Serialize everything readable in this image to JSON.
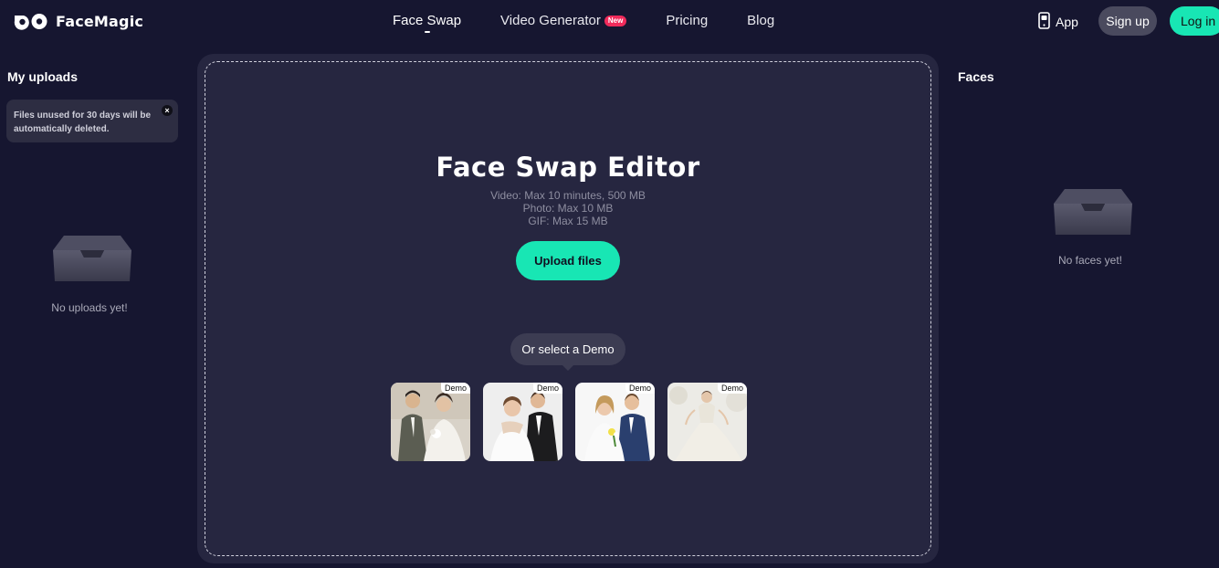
{
  "header": {
    "logo_text": "FaceMagic",
    "nav": [
      {
        "label": "Face Swap"
      },
      {
        "label": "Video Generator",
        "badge": "New"
      },
      {
        "label": "Pricing"
      },
      {
        "label": "Blog"
      }
    ],
    "app_label": "App",
    "signup_label": "Sign up",
    "login_label": "Log in"
  },
  "uploads": {
    "title": "My uploads",
    "notice": "Files unused for 30 days will be automatically deleted.",
    "close_symbol": "×",
    "empty_text": "No uploads yet!"
  },
  "editor": {
    "title": "Face Swap Editor",
    "limits": [
      "Video: Max 10 minutes, 500 MB",
      "Photo: Max 10 MB",
      "GIF: Max 15 MB"
    ],
    "upload_label": "Upload files",
    "demo_prompt": "Or select a Demo",
    "demos": [
      {
        "tag": "Demo"
      },
      {
        "tag": "Demo"
      },
      {
        "tag": "Demo"
      },
      {
        "tag": "Demo"
      }
    ]
  },
  "faces": {
    "title": "Faces",
    "empty_text": "No faces yet!"
  },
  "icons": {
    "logo": "facemagic-logo-icon",
    "app": "phone-icon",
    "close": "close-icon",
    "empty": "empty-tray-icon"
  },
  "colors": {
    "background": "#161630",
    "panel": "#262640",
    "accent": "#18e6b4",
    "badge": "#f02b5b"
  }
}
